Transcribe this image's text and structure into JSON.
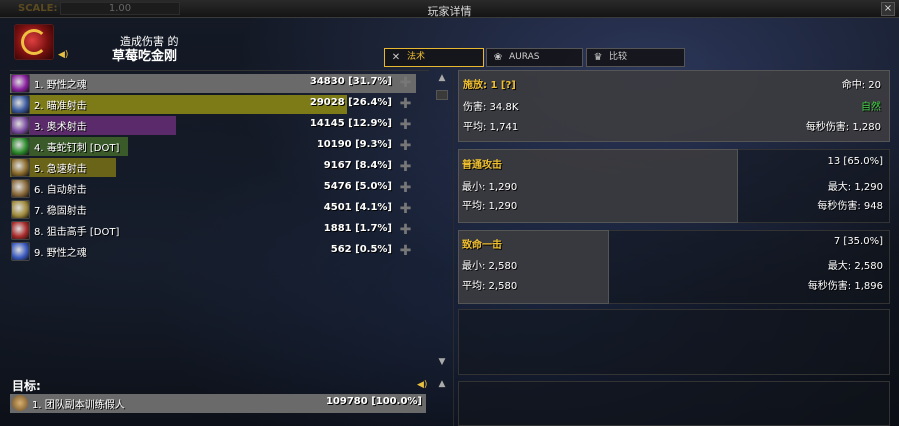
{
  "window": {
    "scale_label": "SCALE:",
    "scale_value": "1.00",
    "title": "玩家详情",
    "close": "×"
  },
  "header": {
    "subtitle": "造成伤害 的",
    "player_name": "草莓吃金刚"
  },
  "tabs": [
    {
      "label": "法术",
      "icon": "crossed-swords-icon",
      "active": true
    },
    {
      "label": "AURAS",
      "icon": "paw-icon",
      "active": false
    },
    {
      "label": "比较",
      "icon": "crown-icon",
      "active": false
    }
  ],
  "spells": [
    {
      "label": "1. 野性之魂",
      "value": "34830 [31.7%]",
      "bar_color": "#6a6a6a",
      "fraction": 1.0,
      "icon_color": "#8a1fa0"
    },
    {
      "label": "2. 瞄准射击",
      "value": "29028 [26.4%]",
      "bar_color": "#7d7a18",
      "fraction": 0.83,
      "icon_color": "#3a5aa0"
    },
    {
      "label": "3. 奥术射击",
      "value": "14145 [12.9%]",
      "bar_color": "#5a2a6a",
      "fraction": 0.41,
      "icon_color": "#7a4aa0"
    },
    {
      "label": "4. 毒蛇钉刺 [DOT]",
      "value": "10190 [9.3%]",
      "bar_color": "#3a5a2a",
      "fraction": 0.29,
      "icon_color": "#2a8a2a"
    },
    {
      "label": "5. 急速射击",
      "value": "9167 [8.4%]",
      "bar_color": "#6a6418",
      "fraction": 0.26,
      "icon_color": "#8a6a2a"
    },
    {
      "label": "6. 自动射击",
      "value": "5476 [5.0%]",
      "bar_color": "#2a2a2a",
      "fraction": 0.0,
      "icon_color": "#8a6a3a"
    },
    {
      "label": "7. 稳固射击",
      "value": "4501 [4.1%]",
      "bar_color": "#2a2a2a",
      "fraction": 0.0,
      "icon_color": "#a08a3a"
    },
    {
      "label": "8. 狙击高手 [DOT]",
      "value": "1881 [1.7%]",
      "bar_color": "#2a2a2a",
      "fraction": 0.0,
      "icon_color": "#aa2a2a"
    },
    {
      "label": "9. 野性之魂",
      "value": "562 [0.5%]",
      "bar_color": "#2a2a2a",
      "fraction": 0.0,
      "icon_color": "#3a5ac0"
    }
  ],
  "target": {
    "heading": "目标:",
    "label": "1. 团队副本训练假人",
    "value": "109780 [100.0%]"
  },
  "details": {
    "casts": {
      "title": "施放: 1 [?]",
      "hits": "命中: 20",
      "damage": "伤害: 34.8K",
      "school": "自然",
      "average": "平均: 1,741",
      "dps": "每秒伤害: 1,280"
    },
    "normal": {
      "title": "普通攻击",
      "count": "13 [65.0%]",
      "min": "最小: 1,290",
      "max": "最大: 1,290",
      "average": "平均: 1,290",
      "dps": "每秒伤害: 948"
    },
    "crit": {
      "title": "致命一击",
      "count": "7 [35.0%]",
      "min": "最小: 2,580",
      "max": "最大: 2,580",
      "average": "平均: 2,580",
      "dps": "每秒伤害: 1,896"
    }
  },
  "colors": {
    "accent": "#f0c030",
    "school": "#40d040"
  }
}
